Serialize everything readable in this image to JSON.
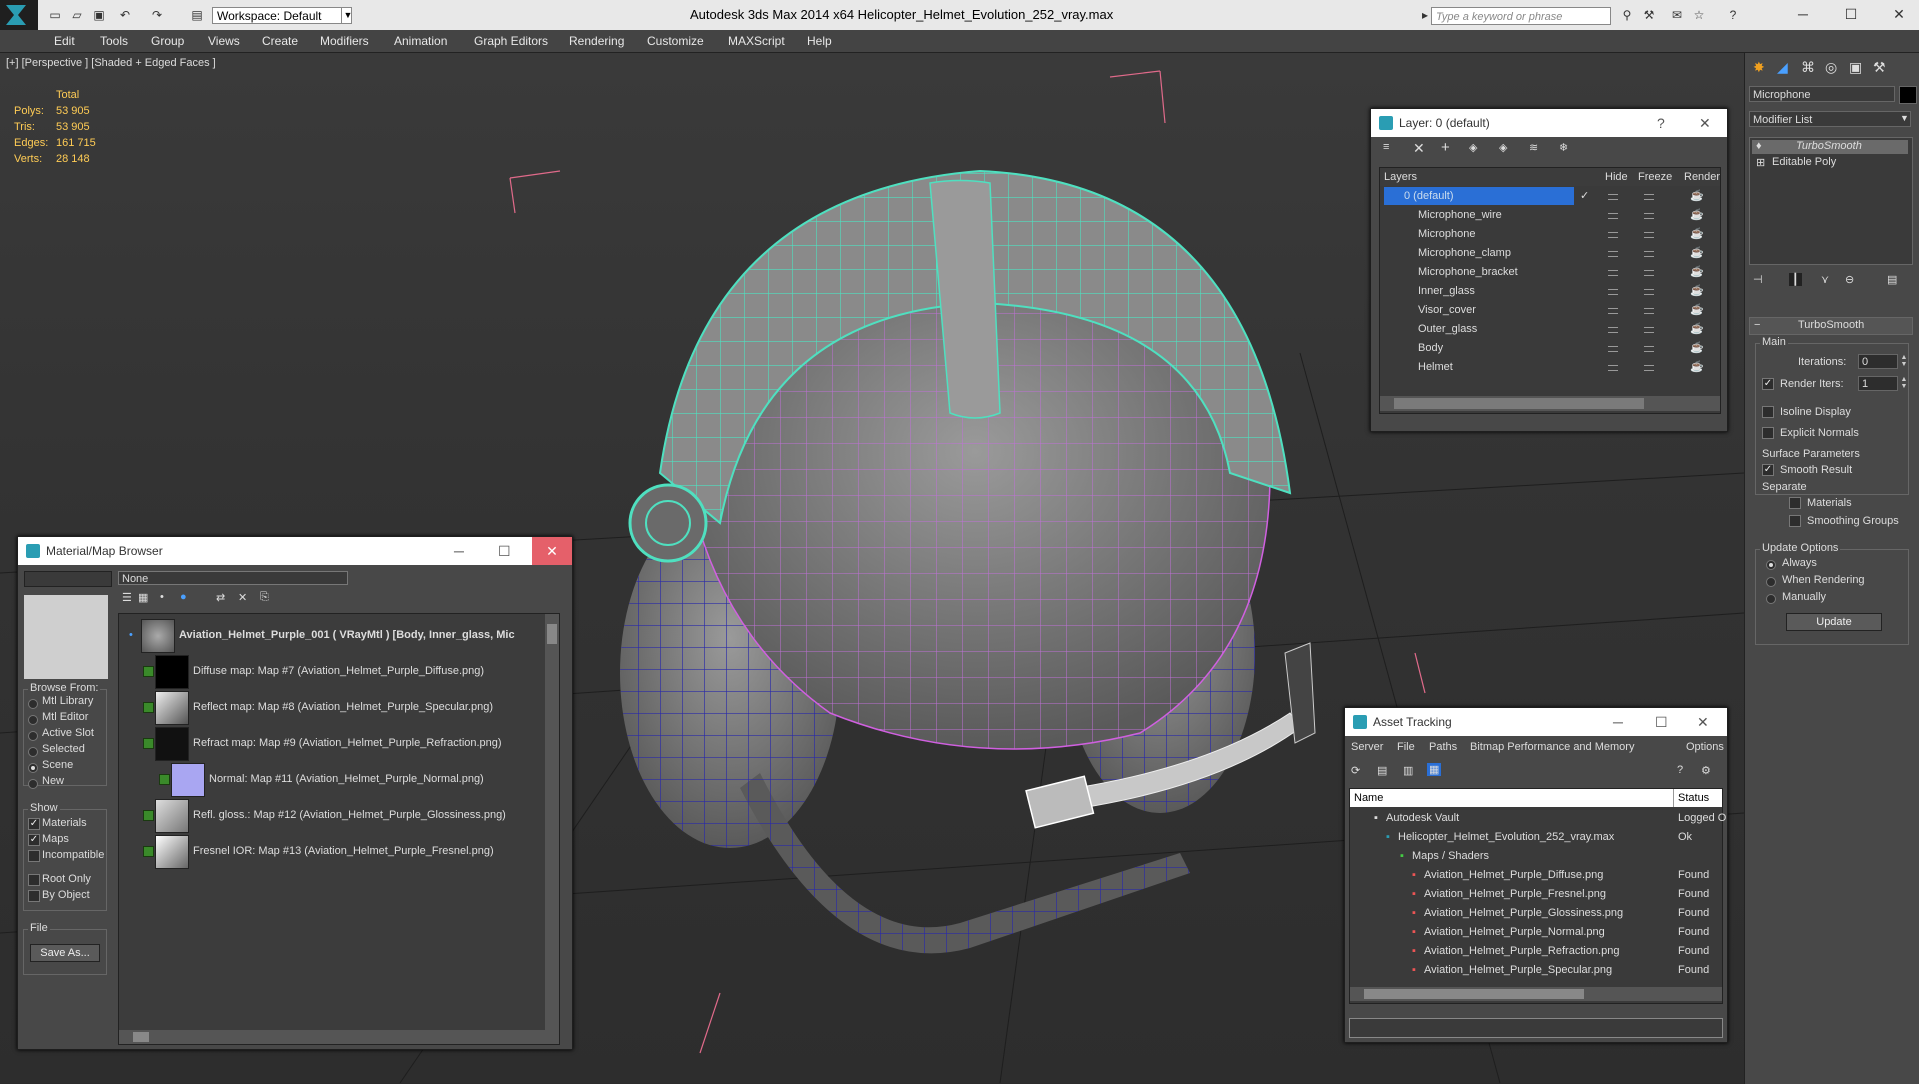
{
  "app": {
    "title": "Autodesk 3ds Max  2014 x64     Helicopter_Helmet_Evolution_252_vray.max",
    "workspace": "Workspace: Default",
    "search_placeholder": "Type a keyword or phrase"
  },
  "menu": [
    "Edit",
    "Tools",
    "Group",
    "Views",
    "Create",
    "Modifiers",
    "Animation",
    "Graph Editors",
    "Rendering",
    "Customize",
    "MAXScript",
    "Help"
  ],
  "viewport": {
    "label": "[+] [Perspective ] [Shaded + Edged Faces ]",
    "stats": {
      "header": "Total",
      "rows": [
        {
          "k": "Polys:",
          "v": "53 905"
        },
        {
          "k": "Tris:",
          "v": "53 905"
        },
        {
          "k": "Edges:",
          "v": "161 715"
        },
        {
          "k": "Verts:",
          "v": "28 148"
        }
      ]
    }
  },
  "layers": {
    "title": "Layer: 0 (default)",
    "help": "?",
    "columns": [
      "Layers",
      "Hide",
      "Freeze",
      "Render"
    ],
    "items": [
      "0 (default)",
      "Microphone_wire",
      "Microphone",
      "Microphone_clamp",
      "Microphone_bracket",
      "Inner_glass",
      "Visor_cover",
      "Outer_glass",
      "Body",
      "Helmet"
    ]
  },
  "material_browser": {
    "title": "Material/Map Browser",
    "search_value": "None",
    "root": "Aviation_Helmet_Purple_001  ( VRayMtl )  [Body, Inner_glass, Mic",
    "maps": [
      "Diffuse map: Map #7 (Aviation_Helmet_Purple_Diffuse.png)",
      "Reflect map: Map #8 (Aviation_Helmet_Purple_Specular.png)",
      "Refract map: Map #9 (Aviation_Helmet_Purple_Refraction.png)",
      "Normal: Map #11 (Aviation_Helmet_Purple_Normal.png)",
      "Refl. gloss.: Map #12 (Aviation_Helmet_Purple_Glossiness.png)",
      "Fresnel IOR: Map #13 (Aviation_Helmet_Purple_Fresnel.png)"
    ],
    "browse_from": {
      "title": "Browse From:",
      "options": [
        "Mtl Library",
        "Mtl Editor",
        "Active Slot",
        "Selected",
        "Scene",
        "New"
      ],
      "selected": "Scene"
    },
    "show": {
      "title": "Show",
      "materials": "Materials",
      "maps": "Maps",
      "incompatible": "Incompatible",
      "root_only": "Root Only",
      "by_object": "By Object"
    },
    "file": {
      "title": "File",
      "save_as": "Save As..."
    }
  },
  "asset_tracking": {
    "title": "Asset Tracking",
    "menu": [
      "Server",
      "File",
      "Paths",
      "Bitmap Performance and Memory",
      "Options"
    ],
    "columns": [
      "Name",
      "Status"
    ],
    "rows": [
      {
        "name": "Autodesk Vault",
        "status": "Logged O"
      },
      {
        "name": "Helicopter_Helmet_Evolution_252_vray.max",
        "status": "Ok"
      },
      {
        "name": "Maps / Shaders",
        "status": ""
      },
      {
        "name": "Aviation_Helmet_Purple_Diffuse.png",
        "status": "Found"
      },
      {
        "name": "Aviation_Helmet_Purple_Fresnel.png",
        "status": "Found"
      },
      {
        "name": "Aviation_Helmet_Purple_Glossiness.png",
        "status": "Found"
      },
      {
        "name": "Aviation_Helmet_Purple_Normal.png",
        "status": "Found"
      },
      {
        "name": "Aviation_Helmet_Purple_Refraction.png",
        "status": "Found"
      },
      {
        "name": "Aviation_Helmet_Purple_Specular.png",
        "status": "Found"
      }
    ]
  },
  "command_panel": {
    "object_name": "Microphone",
    "modifier_list": "Modifier List",
    "stack": [
      "TurboSmooth",
      "Editable Poly"
    ],
    "rollout": "TurboSmooth",
    "main": {
      "title": "Main",
      "iterations_label": "Iterations:",
      "iterations": "0",
      "render_iters_label": "Render Iters:",
      "render_iters": "1",
      "isoline": "Isoline Display",
      "explicit": "Explicit Normals"
    },
    "surface": {
      "title": "Surface Parameters",
      "smooth": "Smooth Result",
      "separate": "Separate",
      "materials": "Materials",
      "smoothing": "Smoothing Groups"
    },
    "update": {
      "title": "Update Options",
      "always": "Always",
      "when_rendering": "When Rendering",
      "manually": "Manually",
      "button": "Update"
    }
  }
}
